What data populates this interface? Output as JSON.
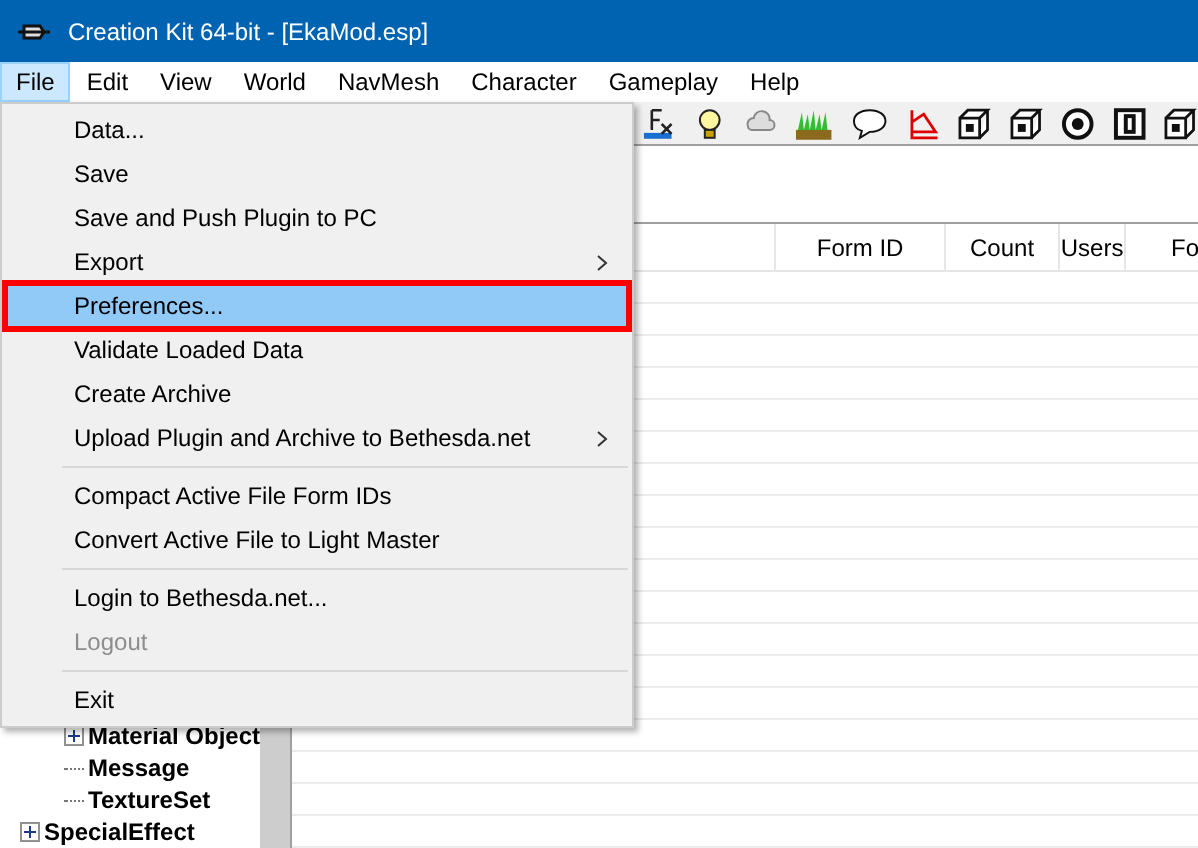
{
  "window": {
    "title": "Creation Kit 64-bit - [EkaMod.esp]"
  },
  "menu_bar": [
    {
      "label": "File",
      "selected": true
    },
    {
      "label": "Edit",
      "selected": false
    },
    {
      "label": "View",
      "selected": false
    },
    {
      "label": "World",
      "selected": false
    },
    {
      "label": "NavMesh",
      "selected": false
    },
    {
      "label": "Character",
      "selected": false
    },
    {
      "label": "Gameplay",
      "selected": false
    },
    {
      "label": "Help",
      "selected": false
    }
  ],
  "file_menu": [
    {
      "kind": "item",
      "label": "Data...",
      "selected": false,
      "disabled": false,
      "submenu": false,
      "outlined": false
    },
    {
      "kind": "item",
      "label": "Save",
      "selected": false,
      "disabled": false,
      "submenu": false,
      "outlined": false
    },
    {
      "kind": "item",
      "label": "Save and Push Plugin to PC",
      "selected": false,
      "disabled": false,
      "submenu": false,
      "outlined": false
    },
    {
      "kind": "item",
      "label": "Export",
      "selected": false,
      "disabled": false,
      "submenu": true,
      "outlined": false
    },
    {
      "kind": "item",
      "label": "Preferences...",
      "selected": true,
      "disabled": false,
      "submenu": false,
      "outlined": true
    },
    {
      "kind": "item",
      "label": "Validate Loaded Data",
      "selected": false,
      "disabled": false,
      "submenu": false,
      "outlined": false
    },
    {
      "kind": "item",
      "label": "Create Archive",
      "selected": false,
      "disabled": false,
      "submenu": false,
      "outlined": false
    },
    {
      "kind": "item",
      "label": "Upload Plugin and Archive to Bethesda.net",
      "selected": false,
      "disabled": false,
      "submenu": true,
      "outlined": false
    },
    {
      "kind": "separator"
    },
    {
      "kind": "item",
      "label": "Compact Active File Form IDs",
      "selected": false,
      "disabled": false,
      "submenu": false,
      "outlined": false
    },
    {
      "kind": "item",
      "label": "Convert Active File to Light Master",
      "selected": false,
      "disabled": false,
      "submenu": false,
      "outlined": false
    },
    {
      "kind": "separator"
    },
    {
      "kind": "item",
      "label": "Login to Bethesda.net...",
      "selected": false,
      "disabled": false,
      "submenu": false,
      "outlined": false
    },
    {
      "kind": "item",
      "label": "Logout",
      "selected": false,
      "disabled": true,
      "submenu": false,
      "outlined": false
    },
    {
      "kind": "separator"
    },
    {
      "kind": "item",
      "label": "Exit",
      "selected": false,
      "disabled": false,
      "submenu": false,
      "outlined": false
    }
  ],
  "table": {
    "columns": [
      "Form ID",
      "Count",
      "Users",
      "Fo"
    ]
  },
  "tree": [
    {
      "label": "Material Object",
      "expandable": true,
      "top": false
    },
    {
      "label": "Message",
      "expandable": false,
      "top": false
    },
    {
      "label": "TextureSet",
      "expandable": false,
      "top": false
    },
    {
      "label": "SpecialEffect",
      "expandable": true,
      "top": true
    }
  ]
}
